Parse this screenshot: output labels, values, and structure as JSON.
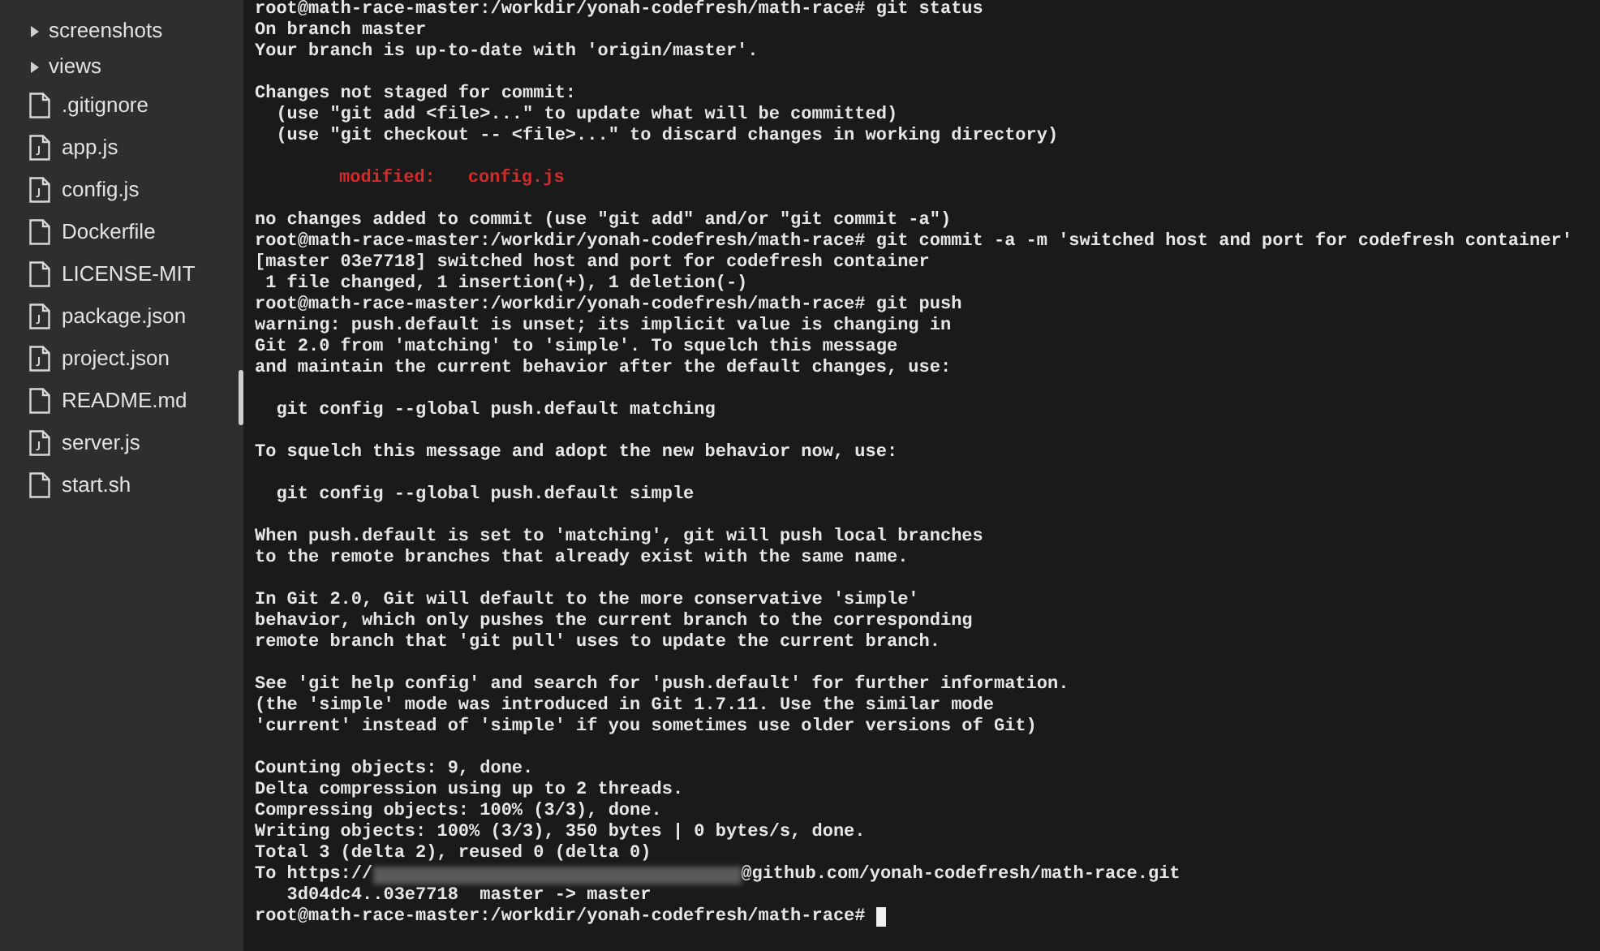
{
  "sidebar": {
    "items": [
      {
        "kind": "folder",
        "label": "screenshots"
      },
      {
        "kind": "folder",
        "label": "views"
      },
      {
        "kind": "file",
        "label": ".gitignore"
      },
      {
        "kind": "script",
        "label": "app.js"
      },
      {
        "kind": "script",
        "label": "config.js"
      },
      {
        "kind": "file",
        "label": "Dockerfile"
      },
      {
        "kind": "file",
        "label": "LICENSE-MIT"
      },
      {
        "kind": "script",
        "label": "package.json"
      },
      {
        "kind": "script",
        "label": "project.json"
      },
      {
        "kind": "file",
        "label": "README.md"
      },
      {
        "kind": "script",
        "label": "server.js"
      },
      {
        "kind": "file",
        "label": "start.sh"
      }
    ]
  },
  "terminal": {
    "lines": [
      {
        "kind": "text",
        "text": "root@math-race-master:/workdir/yonah-codefresh/math-race# git status"
      },
      {
        "kind": "text",
        "text": "On branch master"
      },
      {
        "kind": "text",
        "text": "Your branch is up-to-date with 'origin/master'."
      },
      {
        "kind": "blank"
      },
      {
        "kind": "text",
        "text": "Changes not staged for commit:"
      },
      {
        "kind": "text",
        "text": "  (use \"git add <file>...\" to update what will be committed)"
      },
      {
        "kind": "text",
        "text": "  (use \"git checkout -- <file>...\" to discard changes in working directory)"
      },
      {
        "kind": "blank"
      },
      {
        "kind": "modified",
        "label": "modified:",
        "file": "config.js"
      },
      {
        "kind": "blank"
      },
      {
        "kind": "text",
        "text": "no changes added to commit (use \"git add\" and/or \"git commit -a\")"
      },
      {
        "kind": "text",
        "text": "root@math-race-master:/workdir/yonah-codefresh/math-race# git commit -a -m 'switched host and port for codefresh container'"
      },
      {
        "kind": "text",
        "text": "[master 03e7718] switched host and port for codefresh container"
      },
      {
        "kind": "text",
        "text": " 1 file changed, 1 insertion(+), 1 deletion(-)"
      },
      {
        "kind": "text",
        "text": "root@math-race-master:/workdir/yonah-codefresh/math-race# git push"
      },
      {
        "kind": "text",
        "text": "warning: push.default is unset; its implicit value is changing in"
      },
      {
        "kind": "text",
        "text": "Git 2.0 from 'matching' to 'simple'. To squelch this message"
      },
      {
        "kind": "text",
        "text": "and maintain the current behavior after the default changes, use:"
      },
      {
        "kind": "blank"
      },
      {
        "kind": "text",
        "text": "  git config --global push.default matching"
      },
      {
        "kind": "blank"
      },
      {
        "kind": "text",
        "text": "To squelch this message and adopt the new behavior now, use:"
      },
      {
        "kind": "blank"
      },
      {
        "kind": "text",
        "text": "  git config --global push.default simple"
      },
      {
        "kind": "blank"
      },
      {
        "kind": "text",
        "text": "When push.default is set to 'matching', git will push local branches"
      },
      {
        "kind": "text",
        "text": "to the remote branches that already exist with the same name."
      },
      {
        "kind": "blank"
      },
      {
        "kind": "text",
        "text": "In Git 2.0, Git will default to the more conservative 'simple'"
      },
      {
        "kind": "text",
        "text": "behavior, which only pushes the current branch to the corresponding"
      },
      {
        "kind": "text",
        "text": "remote branch that 'git pull' uses to update the current branch."
      },
      {
        "kind": "blank"
      },
      {
        "kind": "text",
        "text": "See 'git help config' and search for 'push.default' for further information."
      },
      {
        "kind": "text",
        "text": "(the 'simple' mode was introduced in Git 1.7.11. Use the similar mode"
      },
      {
        "kind": "text",
        "text": "'current' instead of 'simple' if you sometimes use older versions of Git)"
      },
      {
        "kind": "blank"
      },
      {
        "kind": "text",
        "text": "Counting objects: 9, done."
      },
      {
        "kind": "text",
        "text": "Delta compression using up to 2 threads."
      },
      {
        "kind": "text",
        "text": "Compressing objects: 100% (3/3), done."
      },
      {
        "kind": "text",
        "text": "Writing objects: 100% (3/3), 350 bytes | 0 bytes/s, done."
      },
      {
        "kind": "text",
        "text": "Total 3 (delta 2), reused 0 (delta 0)"
      },
      {
        "kind": "redacted",
        "before": "To https://",
        "after": "@github.com/yonah-codefresh/math-race.git"
      },
      {
        "kind": "text",
        "text": "   3d04dc4..03e7718  master -> master"
      },
      {
        "kind": "prompt",
        "text": "root@math-race-master:/workdir/yonah-codefresh/math-race#"
      }
    ]
  }
}
